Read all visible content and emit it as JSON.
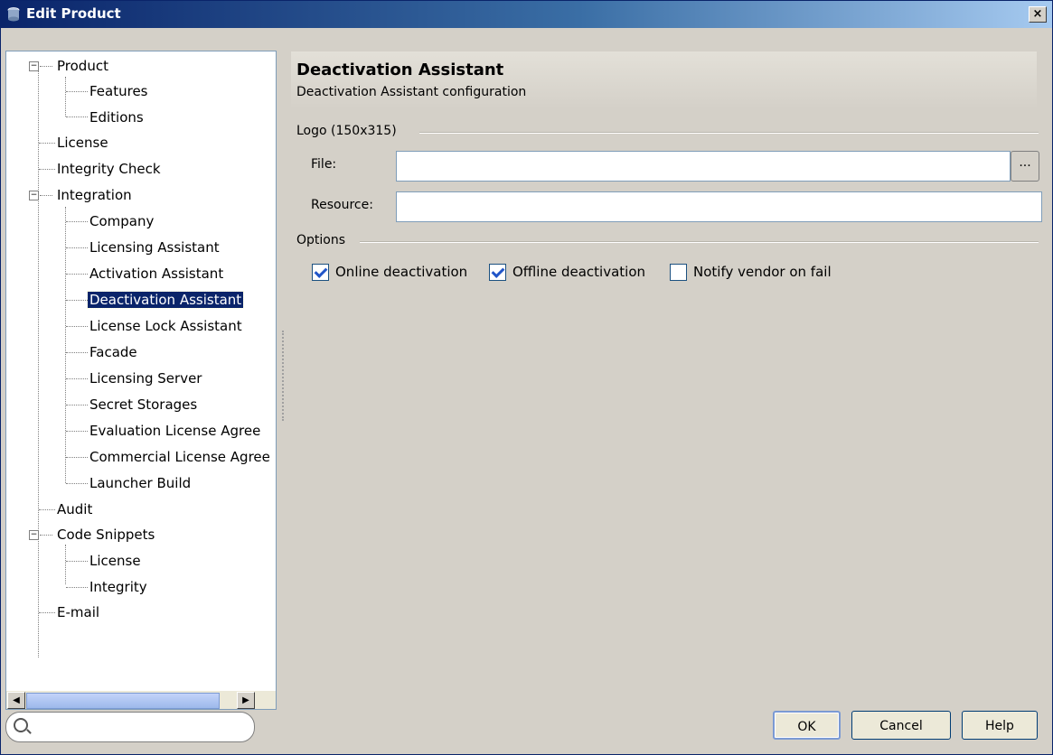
{
  "window": {
    "title": "Edit Product",
    "close_label": "×"
  },
  "tree": {
    "items": [
      {
        "label": "Product"
      },
      {
        "label": "Features"
      },
      {
        "label": "Editions"
      },
      {
        "label": "License"
      },
      {
        "label": "Integrity Check"
      },
      {
        "label": "Integration"
      },
      {
        "label": "Company"
      },
      {
        "label": "Licensing Assistant"
      },
      {
        "label": "Activation Assistant"
      },
      {
        "label": "Deactivation Assistant"
      },
      {
        "label": "License Lock Assistant"
      },
      {
        "label": "Facade"
      },
      {
        "label": "Licensing Server"
      },
      {
        "label": "Secret Storages"
      },
      {
        "label": "Evaluation License Agree"
      },
      {
        "label": "Commercial License Agree"
      },
      {
        "label": "Launcher Build"
      },
      {
        "label": "Audit"
      },
      {
        "label": "Code Snippets"
      },
      {
        "label": "License"
      },
      {
        "label": "Integrity"
      },
      {
        "label": "E-mail"
      }
    ],
    "selected": "Deactivation Assistant"
  },
  "search": {
    "value": "",
    "placeholder": ""
  },
  "content": {
    "title": "Deactivation Assistant",
    "subtitle": "Deactivation Assistant configuration",
    "logo_group": "Logo (150x315)",
    "file_label": "File:",
    "file_value": "",
    "browse_label": "...",
    "resource_label": "Resource:",
    "resource_value": "",
    "options_group": "Options",
    "options": [
      {
        "label": "Online deactivation",
        "checked": true
      },
      {
        "label": "Offline deactivation",
        "checked": true
      },
      {
        "label": "Notify vendor on fail",
        "checked": false
      }
    ]
  },
  "buttons": {
    "ok": "OK",
    "cancel": "Cancel",
    "help": "Help"
  },
  "colors": {
    "title_bar": "#0a246a",
    "selection": "#0a246a",
    "background": "#d4d0c8"
  }
}
